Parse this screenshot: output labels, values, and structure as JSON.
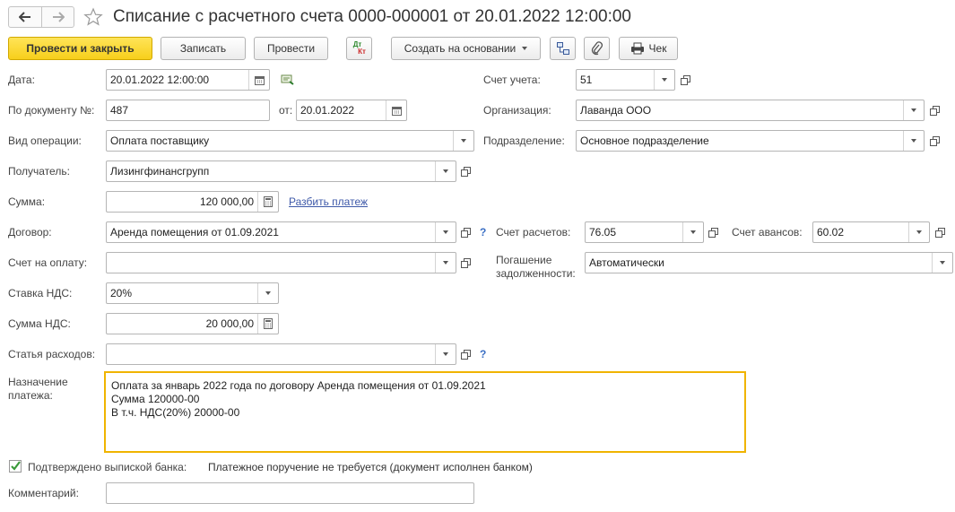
{
  "title": "Списание с расчетного счета 0000-000001 от 20.01.2022 12:00:00",
  "toolbar": {
    "post_close": "Провести и закрыть",
    "save": "Записать",
    "post": "Провести",
    "dt_kt_top": "Дт",
    "dt_kt_bottom": "Кт",
    "create_based": "Создать на основании",
    "check": "Чек"
  },
  "form": {
    "date_label": "Дата:",
    "date_value": "20.01.2022 12:00:00",
    "doc_num_label": "По документу №:",
    "doc_num_value": "487",
    "from_label": "от:",
    "from_value": "20.01.2022",
    "op_type_label": "Вид операции:",
    "op_type_value": "Оплата поставщику",
    "recipient_label": "Получатель:",
    "recipient_value": "Лизингфинансгрупп",
    "amount_label": "Сумма:",
    "amount_value": "120 000,00",
    "split_link": "Разбить платеж",
    "contract_label": "Договор:",
    "contract_value": "Аренда помещения от 01.09.2021",
    "invoice_label": "Счет на оплату:",
    "invoice_value": "",
    "vat_rate_label": "Ставка НДС:",
    "vat_rate_value": "20%",
    "vat_amount_label": "Сумма НДС:",
    "vat_amount_value": "20 000,00",
    "expense_label": "Статья расходов:",
    "expense_value": "",
    "purpose_label_1": "Назначение",
    "purpose_label_2": "платежа:",
    "purpose_line1": "Оплата за январь 2022 года по договору Аренда помещения от 01.09.2021",
    "purpose_line2": "Сумма 120000-00",
    "purpose_line3": "В т.ч. НДС(20%) 20000-00",
    "confirmed_label": "Подтверждено выпиской банка:",
    "confirmed_note": "Платежное поручение не требуется (документ исполнен банком)",
    "comment_label": "Комментарий:",
    "comment_value": "",
    "account_label": "Счет учета:",
    "account_value": "51",
    "org_label": "Организация:",
    "org_value": "Лаванда ООО",
    "division_label": "Подразделение:",
    "division_value": "Основное подразделение",
    "settle_label": "Счет расчетов:",
    "settle_value": "76.05",
    "advance_label": "Счет авансов:",
    "advance_value": "60.02",
    "repay_label_1": "Погашение",
    "repay_label_2": "задолженности:",
    "repay_value": "Автоматически",
    "question_mark": "?"
  },
  "colors": {
    "primary_button": "#f7cf1b",
    "focus_border": "#f0b400",
    "link": "#3d58a8",
    "checkbox": "#3a9a3a"
  }
}
